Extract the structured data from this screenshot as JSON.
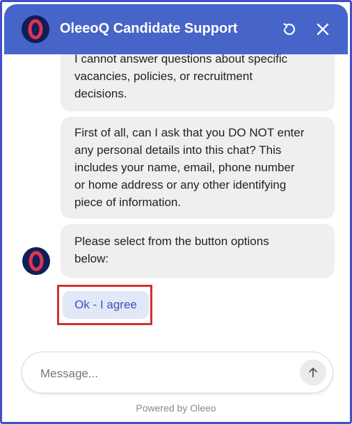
{
  "header": {
    "title": "OleeoQ Candidate Support",
    "logo_icon": "oleeo-logo-icon",
    "refresh_icon": "refresh-icon",
    "close_icon": "close-icon",
    "color": "#4765c9"
  },
  "messages": [
    {
      "lines": [
        "I cannot answer questions about specific",
        "vacancies, policies, or recruitment",
        "decisions."
      ]
    },
    {
      "lines": [
        "First of all, can I ask that you DO NOT enter",
        "any personal details into this chat? This",
        "includes your name, email, phone number",
        "or home address or any other identifying",
        "piece of information."
      ]
    },
    {
      "lines": [
        "Please select from the button options",
        "below:"
      ]
    }
  ],
  "options": {
    "agree_label": "Ok - I agree",
    "highlight_color": "#d32f2f"
  },
  "composer": {
    "placeholder": "Message...",
    "send_icon": "arrow-up-icon"
  },
  "footer": {
    "text": "Powered by Oleeo"
  }
}
